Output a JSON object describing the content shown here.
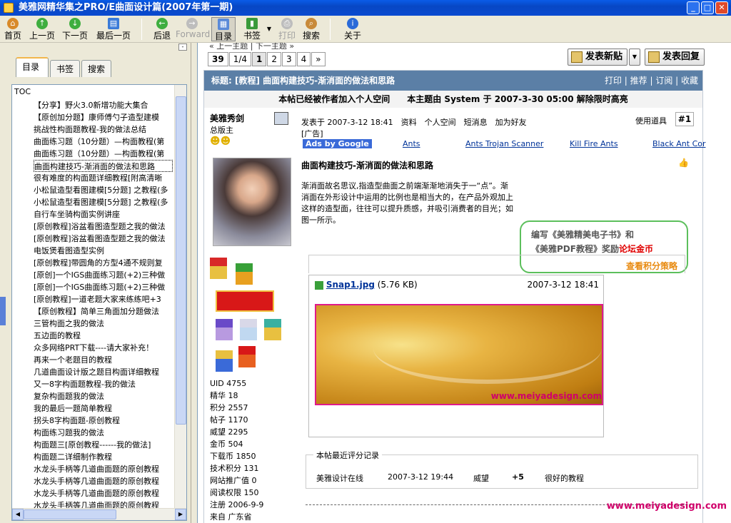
{
  "window": {
    "title": "美雅网精华集之PRO/E曲面设计篇(2007年第一期)",
    "minimize": "_",
    "maximize": "□",
    "close": "✕"
  },
  "toolbar": {
    "home": "首页",
    "prev": "上一页",
    "next": "下一页",
    "last": "最后一页",
    "back": "后退",
    "forward": "Forward",
    "toc": "目录",
    "bookmark": "书签",
    "print": "打印",
    "search": "搜索",
    "about": "关于"
  },
  "left_panel": {
    "tabs": [
      "目录",
      "书签",
      "搜索"
    ],
    "toc_label": "TOC",
    "items": [
      "【分享】野火3.0新增功能大集合",
      "【原创加分题】康师傅勺子造型建模",
      "挑战性构面题教程-我的做法总结",
      "曲面练习题（10分题）—构面教程(第",
      "曲面练习题（10分题）—构面教程(第",
      "曲面构建技巧-渐消面的做法和思路",
      "很有难度的构面题详细教程[附高清晰",
      "小松鼠造型看图建模[5分题] 之教程(多",
      "小松鼠造型看图建模[5分题] 之教程(多",
      "自行车坐骑构面实例讲座",
      "[原创教程]浴盆看图造型题之我的做法",
      "[原创教程]浴盆看图造型题之我的做法",
      "电饭煲看图造型实例",
      "[原创教程]带圆角的方型4通不规则复",
      "[原创]一个IGS曲面练习题(+2)三种做",
      "[原创]一个IGS曲面练习题(+2)三种做",
      "[原创教程]一道老题大家来练练吧+3",
      "【原创教程】简单三角面加分题做法",
      "三管构面之我的做法",
      "五边面的教程",
      "众多网络PRT下载----请大家补充！",
      "再来一个老题目的教程",
      "几道曲面设计版之题目构面详细教程",
      "又一8字构面题教程-我的做法",
      "复杂构面题我的做法",
      "我的最后一题简单教程",
      "拐头8字构面题-原创教程",
      "构面练习题我的做法",
      "构面题三[原创教程------我的做法]",
      "构面题二详细制作教程",
      "水龙头手柄等几道曲面题的原创教程",
      "水龙头手柄等几道曲面题的原创教程",
      "水龙头手柄等几道曲面题的原创教程",
      "水龙头手柄等几道曲面题的原创教程"
    ],
    "selected_index": 5
  },
  "content": {
    "breadcrumb": "« 上一主题 | 下一主题 »",
    "pager": {
      "total": "39",
      "page_of": "1/4",
      "pages": [
        "1",
        "2",
        "3",
        "4"
      ],
      "next": "»"
    },
    "new_post_btn": "发表新贴",
    "reply_btn": "发表回复",
    "post_header": "标题: [教程] 曲面构建技巧-渐消面的做法和思路",
    "post_links": "打印 | 推荐 | 订阅 | 收藏",
    "notice": "本帖已经被作者加入个人空间　　本主题由 System 于 2007-3-30 05:00 解除限时高亮",
    "author": {
      "name": "美雅秀剑",
      "rank": "总版主",
      "stats": [
        "UID 4755",
        "精华 18",
        "积分 2557",
        "帖子 1170",
        "威望 2295",
        "金币 504",
        "下载币 1850",
        "技术积分 131",
        "网站推广值 0",
        "阅读权限 150",
        "注册 2006-9-9",
        "来自 广东省"
      ]
    },
    "meta": "发表于 2007-3-12 18:41　资料　个人空间　短消息　加为好友",
    "tools": "使用道具",
    "floor": "#1",
    "ad_tag": "[广告]",
    "ads": [
      "Ads by Google",
      "Ants",
      "Ants Trojan Scanner",
      "Kill Fire Ants",
      "Black Ant Cor"
    ],
    "post_title": "曲面构建技巧-渐消面的做法和思路",
    "body": "渐消面故名思议,指造型曲面之前端渐渐地消失于一“点”。渐消面在外形设计中运用的比例也是相当大的，在产品外观加上这样的造型面，往往可以提升质感，并吸引消费者的目光；如图一所示。",
    "bubble_line1": "编写《美雅精美电子书》和",
    "bubble_line2a": "《美雅PDF教程》奖励",
    "bubble_line2b": "论坛金币",
    "score_link": "查看积分策略",
    "attachment": {
      "name": "Snap1.jpg",
      "size": "(5.76 KB)",
      "date": "2007-3-12 18:41",
      "watermark": "www.meiyadesign.com"
    },
    "rating": {
      "legend": "本帖最近评分记录",
      "user": "美雅设计在线",
      "date": "2007-3-12 19:44",
      "field": "威望",
      "value": "+5",
      "comment": "很好的教程"
    },
    "footer_watermark": "www.meiyadesign.com"
  },
  "colors": {
    "title_bar": "#0a5ce8",
    "post_header": "#5b7fa6",
    "watermark": "#d0006a",
    "bubble_border": "#5cbf5c"
  }
}
